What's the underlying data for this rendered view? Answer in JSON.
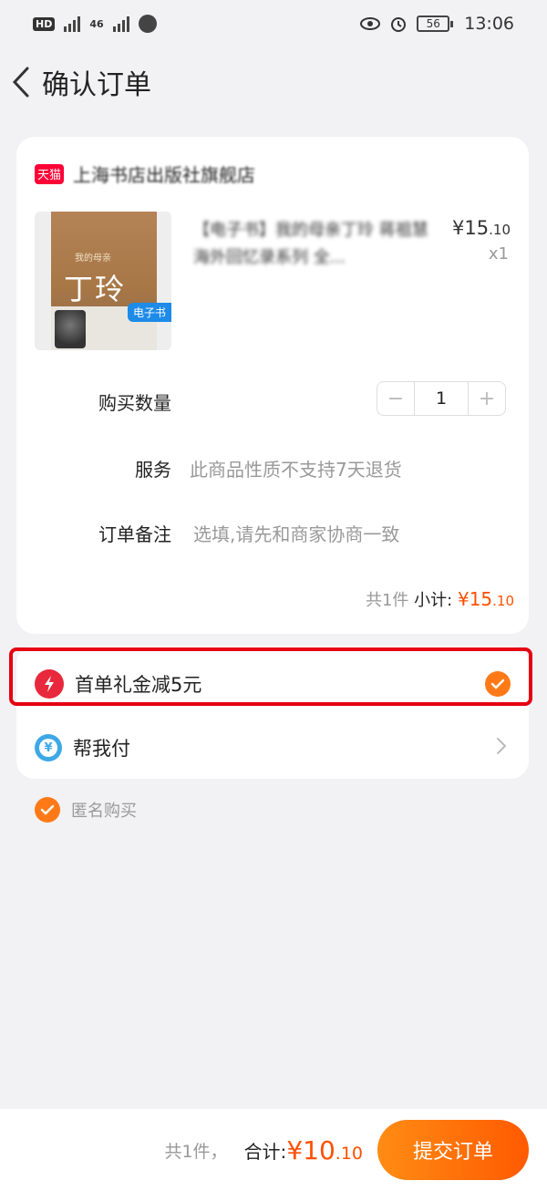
{
  "status_bar": {
    "hd_label": "HD",
    "net_label": "46",
    "battery": "56",
    "time": "13:06"
  },
  "header": {
    "title": "确认订单"
  },
  "order": {
    "shop_badge": "天猫",
    "shop_name": "上海书店出版社旗舰店",
    "product_name_line1": "【电子书】我的母亲丁玲 蒋祖慧",
    "product_name_line2": "海外回忆录系列 全...",
    "ebook_tag": "电子书",
    "book_title": "丁玲",
    "book_subtitle": "我的母亲",
    "price_symbol": "¥",
    "price_int": "15",
    "price_dec": ".10",
    "quantity_x": "x1",
    "qty_label": "购买数量",
    "qty_minus": "−",
    "qty_value": "1",
    "qty_plus": "+",
    "service_label": "服务",
    "service_value": "此商品性质不支持7天退货",
    "note_label": "订单备注",
    "note_placeholder": "选填,请先和商家协商一致",
    "subtotal_count": "共1件",
    "subtotal_label": "小计:",
    "subtotal_symbol": "¥",
    "subtotal_int": "15",
    "subtotal_dec": ".10"
  },
  "discount": {
    "label": "首单礼金减5元",
    "checked": true
  },
  "pay_for_me": {
    "icon_text": "¥",
    "label": "帮我付"
  },
  "anonymous": {
    "label": "匿名购买",
    "checked": true
  },
  "footer": {
    "count": "共1件，",
    "total_label": "合计:",
    "total_symbol": "¥",
    "total_int": "10",
    "total_dec": ".10",
    "submit_label": "提交订单"
  },
  "colors": {
    "accent": "#ff5000",
    "highlight": "#e60012",
    "pay_icon": "#3da8e6"
  }
}
